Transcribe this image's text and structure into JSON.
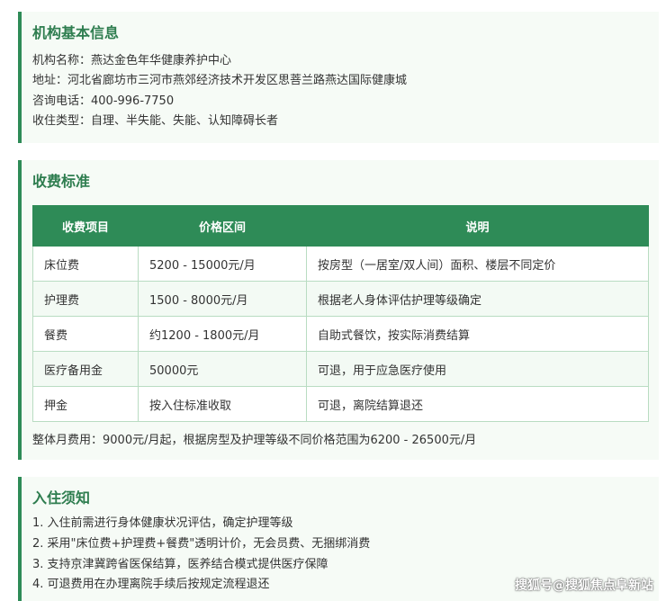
{
  "info": {
    "title": "机构基本信息",
    "lines": [
      "机构名称：燕达金色年华健康养护中心",
      "地址：河北省廊坊市三河市燕郊经济技术开发区思菩兰路燕达国际健康城",
      "咨询电话：400-996-7750",
      "收住类型：自理、半失能、失能、认知障碍长者"
    ]
  },
  "fees": {
    "title": "收费标准",
    "headers": [
      "收费项目",
      "价格区间",
      "说明"
    ],
    "rows": [
      [
        "床位费",
        "5200 - 15000元/月",
        "按房型（一居室/双人间）面积、楼层不同定价"
      ],
      [
        "护理费",
        "1500 - 8000元/月",
        "根据老人身体评估护理等级确定"
      ],
      [
        "餐费",
        "约1200 - 1800元/月",
        "自助式餐饮，按实际消费结算"
      ],
      [
        "医疗备用金",
        "50000元",
        "可退，用于应急医疗使用"
      ],
      [
        "押金",
        "按入住标准收取",
        "可退，离院结算退还"
      ]
    ],
    "summary": "整体月费用：9000元/月起，根据房型及护理等级不同价格范围为6200 - 26500元/月"
  },
  "notice": {
    "title": "入住须知",
    "items": [
      "1. 入住前需进行身体健康状况评估，确定护理等级",
      "2. 采用\"床位费+护理费+餐费\"透明计价，无会员费、无捆绑消费",
      "3. 支持京津冀跨省医保结算，医养结合模式提供医疗保障",
      "4. 可退费用在办理离院手续后按规定流程退还"
    ]
  },
  "watermark": "搜狐号@搜狐焦点阜新站",
  "colors": {
    "accent": "#2e8b57",
    "title": "#2e7d4f",
    "card_bg": "#f6fbf6",
    "table_border": "#b9dcc2"
  }
}
